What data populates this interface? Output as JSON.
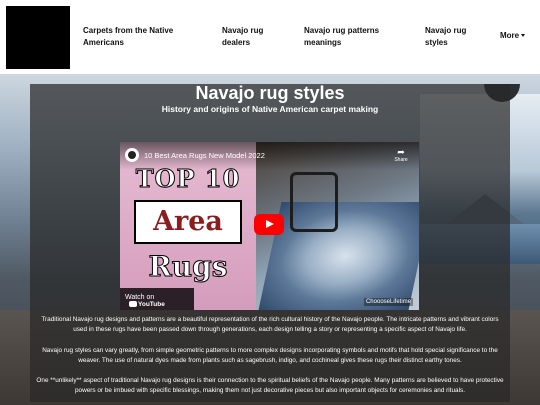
{
  "nav": {
    "links": [
      "Carpets from the Native Americans",
      "Navajo rug dealers",
      "Navajo rug patterns meanings",
      "Navajo rug styles"
    ],
    "more_label": "More"
  },
  "page": {
    "title": "Navajo rug styles",
    "subtitle": "History and origins of Native American carpet making"
  },
  "video": {
    "title": "10 Best Area Rugs New Model 2022",
    "share_label": "Share",
    "thumb_top": "TOP 10",
    "thumb_area": "Area",
    "thumb_rugs": "Rugs",
    "watch_on_label": "Watch on",
    "youtube_label": "YouTube",
    "watermark": "ChoooseLifetime"
  },
  "paragraphs": [
    "Traditional Navajo rug designs and patterns are a beautiful representation of the rich cultural history of the Navajo people. The intricate patterns and vibrant colors used in these rugs have been passed down through generations, each design telling a story or representing a specific aspect of Navajo life.",
    "Navajo rug styles can vary greatly, from simple geometric patterns to more complex designs incorporating symbols and motifs that hold special significance to the weaver. The use of natural dyes made from plants such as sagebrush, indigo, and cochineal gives these rugs their distinct earthy tones.",
    "One **unlikely** aspect of traditional Navajo rug designs is their connection to the spiritual beliefs of the Navajo people. Many patterns are believed to have protective powers or be imbued with specific blessings, making them not just decorative pieces but also important objects for ceremonies and rituals."
  ]
}
